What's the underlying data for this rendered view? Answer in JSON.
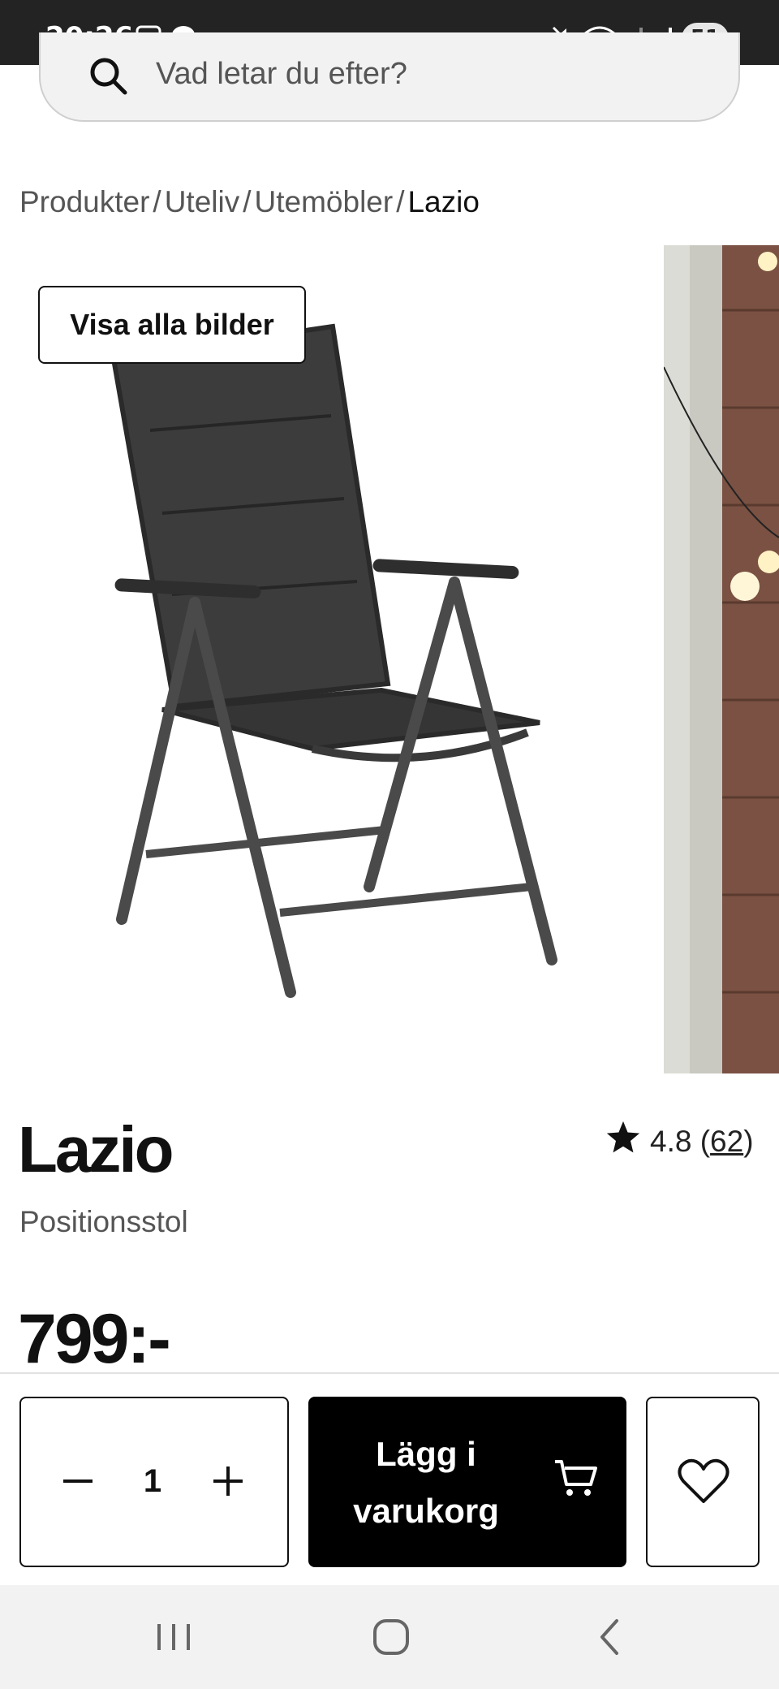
{
  "status_bar": {
    "time": "20:26",
    "battery": "51"
  },
  "search": {
    "placeholder": "Vad letar du efter?"
  },
  "breadcrumb": {
    "items": [
      "Produkter",
      "Uteliv",
      "Utemöbler"
    ],
    "separator": "/",
    "current": "Lazio"
  },
  "gallery": {
    "show_all_label": "Visa alla bilder"
  },
  "product": {
    "title": "Lazio",
    "subtitle": "Positionsstol",
    "rating": "4.8",
    "review_count": "62",
    "price": "799:-"
  },
  "action_bar": {
    "quantity": "1",
    "add_to_cart_line1": "Lägg i",
    "add_to_cart_line2": "varukorg"
  },
  "colors": {
    "accent": "#000000",
    "status_bar_bg": "#232323",
    "nav_bar_bg": "#f2f2f2"
  }
}
